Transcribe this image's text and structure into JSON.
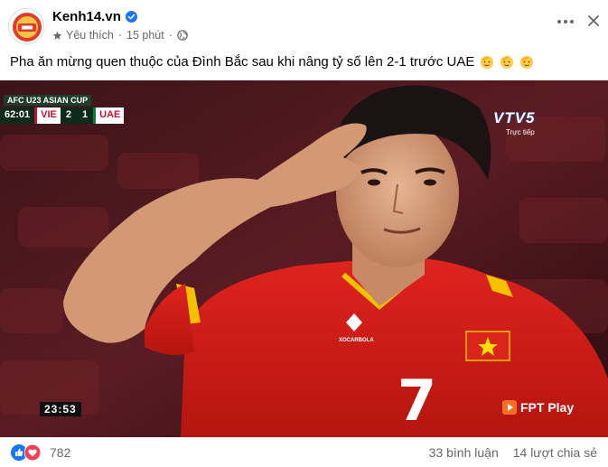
{
  "post": {
    "author": "Kenh14.vn",
    "reaction_type": "Yêu thích",
    "separator": "·",
    "time": "15 phút",
    "caption": "Pha ăn mừng quen thuộc của Đình Bắc sau khi nâng tỷ số lên 2-1 trước UAE"
  },
  "scoreboard": {
    "competition": "AFC U23 ASIAN CUP",
    "clock": "62:01",
    "home_team": "VIE",
    "home_score": "2",
    "away_score": "1",
    "away_team": "UAE"
  },
  "broadcast": {
    "channel_logo": "VTV5",
    "live_label": "Trực tiếp",
    "replay_clock": "23:53",
    "streamer": "FPT Play",
    "jersey_number": "7",
    "sponsor": "XOCARBOLA"
  },
  "footer": {
    "reaction_count": "782",
    "comments": "33 bình luận",
    "shares": "14 lượt chia sẻ"
  },
  "colors": {
    "accent_blue": "#1877f2",
    "muted_text": "#65676b",
    "jersey_red": "#d81e1e",
    "jersey_yellow": "#f2c200",
    "love_red": "#f33e58"
  }
}
